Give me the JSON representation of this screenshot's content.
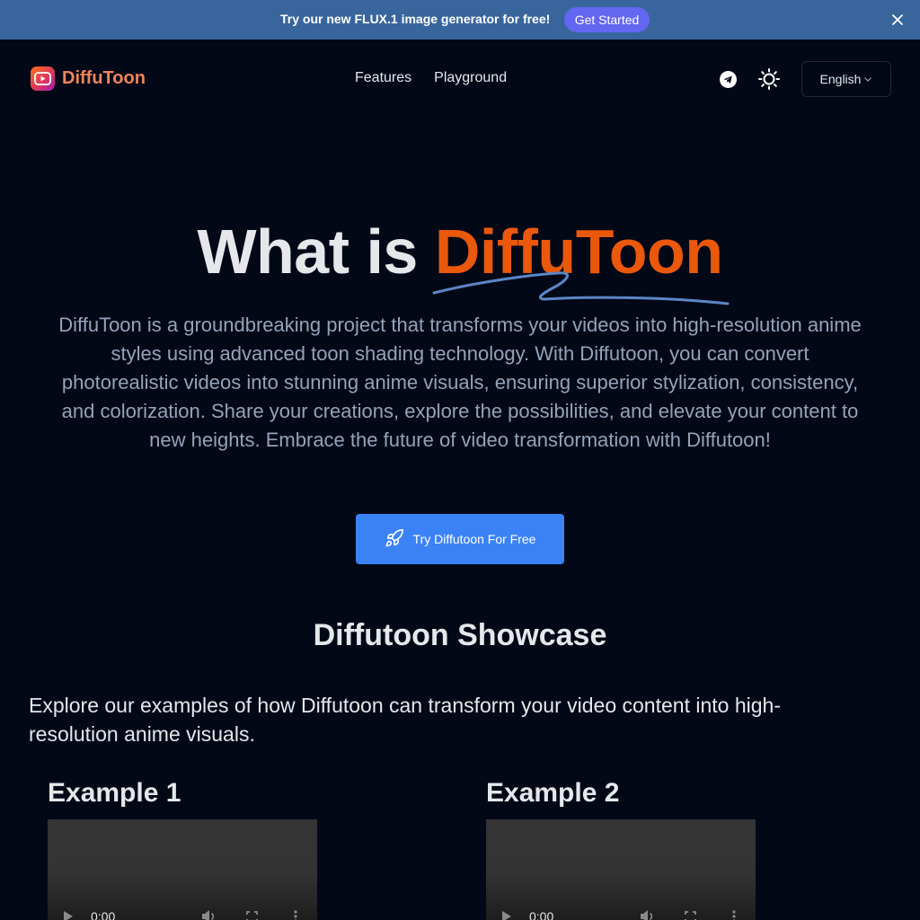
{
  "banner": {
    "text": "Try our new FLUX.1 image generator for free!",
    "button_label": "Get Started",
    "close_icon": "close-icon",
    "background": "#38669c",
    "button_color": "#6366f1"
  },
  "header": {
    "logo_text": "DiffuToon",
    "logo_icon": "play-video-icon",
    "nav": [
      {
        "label": "Features"
      },
      {
        "label": "Playground"
      }
    ],
    "telegram_icon": "telegram-icon",
    "theme_icon": "sun-icon",
    "language": {
      "selected": "English",
      "icon": "chevron-down-icon"
    }
  },
  "hero": {
    "title_prefix": "What is ",
    "title_accent": "DiffuToon",
    "accent_color": "#ea580c",
    "description": "DiffuToon is a groundbreaking project that transforms your videos into high-resolution anime styles using advanced toon shading technology. With Diffutoon, you can convert photorealistic videos into stunning anime visuals, ensuring superior stylization, consistency, and colorization. Share your creations, explore the possibilities, and elevate your content to new heights. Embrace the future of video transformation with Diffutoon!",
    "cta_label": "Try Diffutoon For Free",
    "cta_icon": "rocket-icon",
    "cta_color": "#3b82f6"
  },
  "showcase": {
    "title": "Diffutoon Showcase",
    "description": "Explore our examples of how Diffutoon can transform your video content into high-resolution anime visuals.",
    "examples": [
      {
        "title": "Example 1",
        "time": "0:00"
      },
      {
        "title": "Example 2",
        "time": "0:00"
      }
    ]
  }
}
